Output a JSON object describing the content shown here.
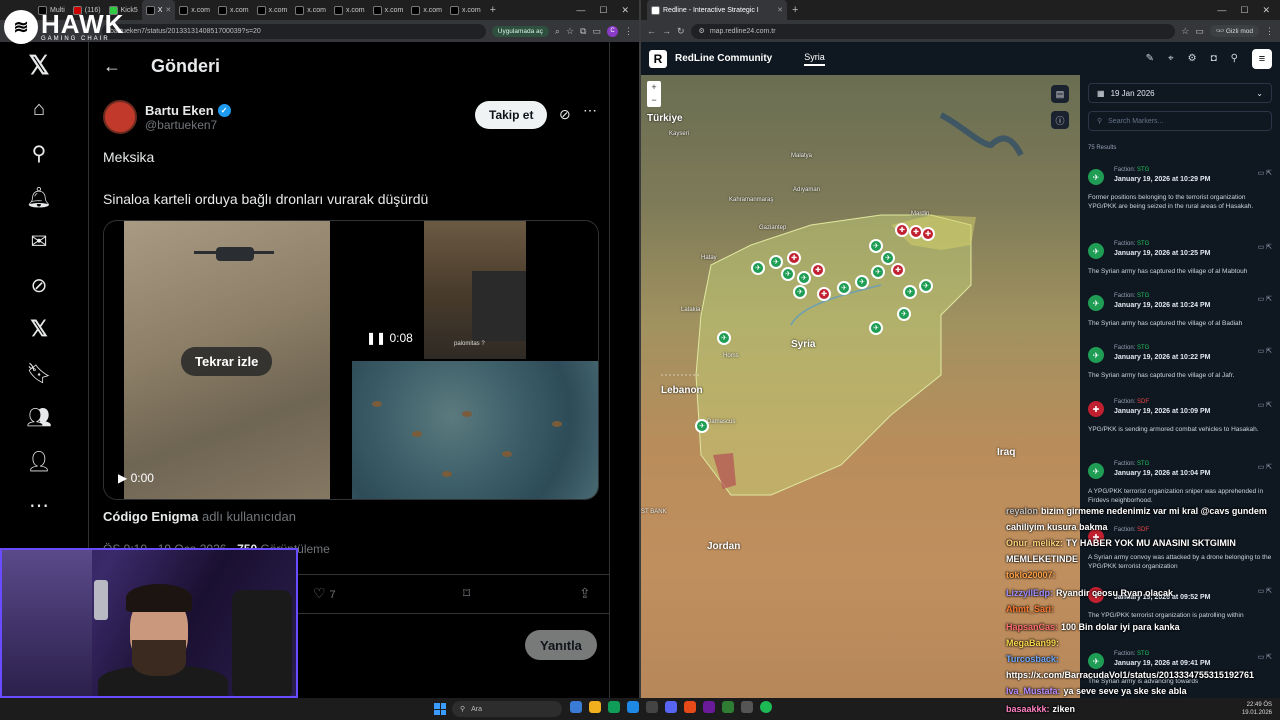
{
  "left_browser": {
    "tabs": [
      {
        "label": "Multi",
        "active": false
      },
      {
        "label": "(116)",
        "active": false
      },
      {
        "label": "Kick5",
        "active": false
      },
      {
        "label": "X",
        "active": true
      },
      {
        "label": "x.com",
        "active": false
      },
      {
        "label": "x.com",
        "active": false
      },
      {
        "label": "x.com",
        "active": false
      },
      {
        "label": "x.com",
        "active": false
      },
      {
        "label": "x.com",
        "active": false
      },
      {
        "label": "x.com",
        "active": false
      },
      {
        "label": "x.com",
        "active": false
      },
      {
        "label": "x.com",
        "active": false
      },
      {
        "label": "x.com",
        "active": false
      }
    ],
    "url": "bartueken7/status/2013313140851700039?s=20",
    "app_pill": "Uygulamada aç"
  },
  "overlay_logo": {
    "brand": "HAWK",
    "sub": "GAMING CHAIR"
  },
  "x_sidebar": [
    "x-logo",
    "home",
    "search",
    "notifications",
    "messages",
    "grok",
    "premium",
    "bookmarks",
    "communities",
    "profile",
    "more"
  ],
  "post": {
    "header_title": "Gönderi",
    "author_name": "Bartu Eken",
    "author_handle": "@bartueken7",
    "follow_label": "Takip et",
    "line1": "Meksika",
    "line2": "Sinaloa karteli orduya bağlı dronları vurarak düşürdü",
    "replay_label": "Tekrar izle",
    "video1_time": "0:00",
    "video2_time": "0:08",
    "video2_caption": "palomitas ?",
    "byline_name": "Código Enigma",
    "byline_suffix": "adlı kullanıcıdan",
    "time": "ÖS 9:10 · 19 Oca 2026 ·",
    "views": "750",
    "views_label": "Görüntüleme",
    "likes": "7",
    "reply_label": "Yanıtla"
  },
  "right_browser": {
    "tab_label": "Redline - Interactive Strategic I",
    "url": "map.redline24.com.tr",
    "incognito": "Gizli mod"
  },
  "redline": {
    "app_name": "RedLine Community",
    "active_tab": "Syria",
    "map_labels": {
      "turkey": "Türkiye",
      "syria": "Syria",
      "lebanon": "Lebanon",
      "jordan": "Jordan",
      "iraq": "Iraq",
      "kayseri": "Kayseri",
      "malatya": "Malatya",
      "adiyaman": "Adıyaman",
      "kahramanmaras": "Kahramanmaraş",
      "gaziantep": "Gaziantep",
      "mardin": "Mardin",
      "hatay": "Hatay",
      "latakia": "Latakia",
      "homs": "Homs",
      "damascus": "Damascus",
      "mosul": "Mosul",
      "st_bank": "ST BANK"
    },
    "date_filter": "19 Jan 2026",
    "search_placeholder": "Search Markers...",
    "results": "75 Results",
    "events": [
      {
        "faction": "STG",
        "color": "g",
        "date": "January 19, 2026 at 10:29 PM",
        "text": "Former positions belonging to the terrorist organization YPG/PKK are being seized in the rural areas of Hasakah."
      },
      {
        "faction": "STG",
        "color": "g",
        "date": "January 19, 2026 at 10:25 PM",
        "text": "The Syrian army has captured the village of al Mabtouh"
      },
      {
        "faction": "STG",
        "color": "g",
        "date": "January 19, 2026 at 10:24 PM",
        "text": "The Syrian army has captured the village of al Badiah"
      },
      {
        "faction": "STG",
        "color": "g",
        "date": "January 19, 2026 at 10:22 PM",
        "text": "The Syrian army has captured the village of al Jafr."
      },
      {
        "faction": "SDF",
        "color": "r",
        "date": "January 19, 2026 at 10:09 PM",
        "text": "YPG/PKK is sending armored combat vehicles to Hasakah."
      },
      {
        "faction": "STG",
        "color": "g",
        "date": "January 19, 2026 at 10:04 PM",
        "text": "A YPG/PKK terrorist organization sniper was apprehended in Firdevs neighborhood."
      },
      {
        "faction": "SDF",
        "color": "r",
        "date": "",
        "text": "A Syrian army convoy was attacked by a drone belonging to the YPG/PKK terrorist organization"
      },
      {
        "faction": "",
        "color": "r",
        "date": "January 19, 2026 at 09:52 PM",
        "text": "The YPG/PKK terrorist organization is patrolling within"
      },
      {
        "faction": "STG",
        "color": "g",
        "date": "January 19, 2026 at 09:41 PM",
        "text": "The Syrian army is advancing towards"
      }
    ]
  },
  "chat": [
    {
      "user": "reyalon",
      "ucolor": "#c0c0c0",
      "msg": "bizim girmeme nedenimiz var mi kral @cavs gundem"
    },
    {
      "user": "",
      "ucolor": "#fff",
      "msg": "cahiliyim kusura bakma"
    },
    {
      "user": "Onur_melikz:",
      "ucolor": "#ffd27a",
      "msg": "TY HABER YOK MU ANASINI SKTGIMIN"
    },
    {
      "user": "",
      "ucolor": "#fff",
      "msg": "MEMLEKETINDE"
    },
    {
      "user": "toklo20007:",
      "ucolor": "#ff9f43",
      "msg": ""
    },
    {
      "user": "LizzyllEdp:",
      "ucolor": "#9b8cff",
      "msg": "Ryandir ceosu Ryan olacak"
    },
    {
      "user": "Ahmt_Sari:",
      "ucolor": "#ff7a30",
      "msg": ""
    },
    {
      "user": "HapsanCas:",
      "ucolor": "#ff6f6f",
      "msg": "100 Bin dolar iyi para kanka"
    },
    {
      "user": "MegaBan99:",
      "ucolor": "#f9d64d",
      "msg": ""
    },
    {
      "user": "Turcosback:",
      "ucolor": "#6fa8ff",
      "msg": ""
    },
    {
      "user": "",
      "ucolor": "#fff",
      "msg": "https://x.com/BarracudaVol1/status/2013334755315192761"
    },
    {
      "user": "Iva_Mustafa:",
      "ucolor": "#b48cff",
      "msg": "ya seve seve ya ske ske abla"
    },
    {
      "user": "basaakkk:",
      "ucolor": "#ff80c0",
      "msg": "ziken"
    }
  ],
  "taskbar": {
    "search": "Ara",
    "time": "22:49 ÖS",
    "date": "19.01.2026"
  }
}
